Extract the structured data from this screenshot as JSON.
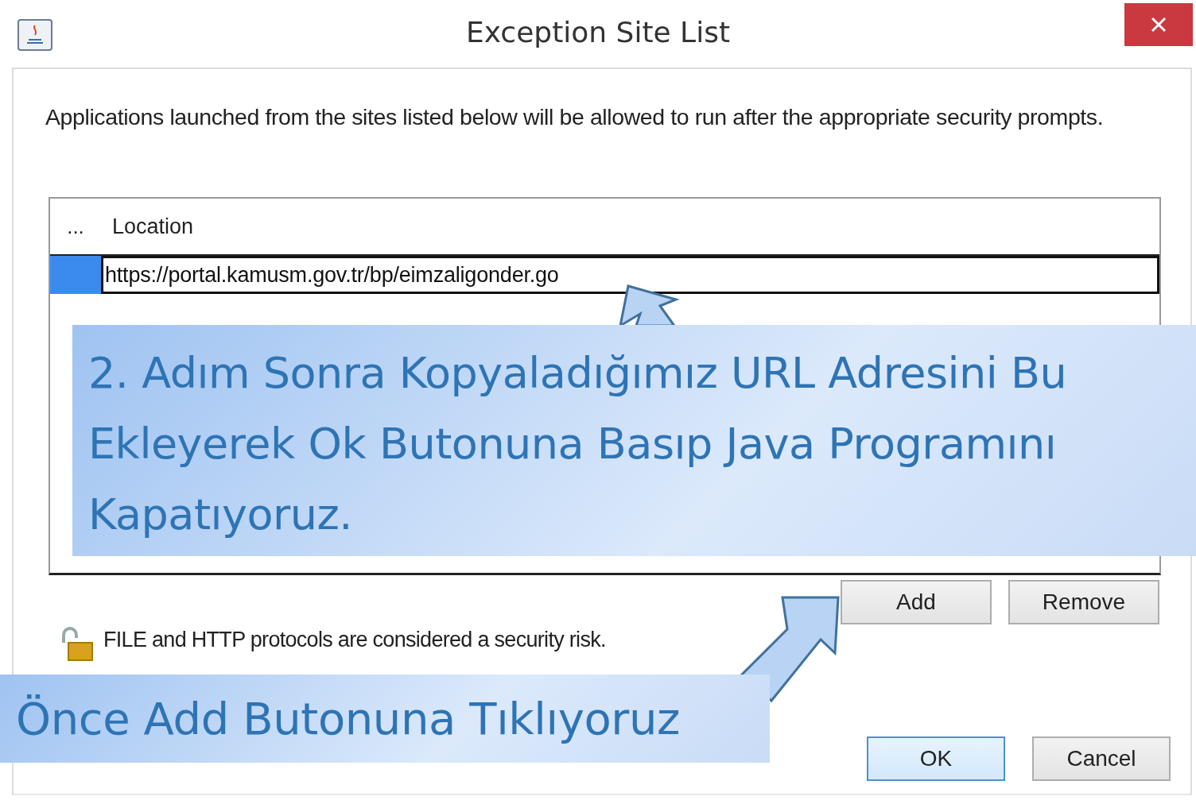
{
  "window": {
    "title": "Exception Site List"
  },
  "description": "Applications launched from the sites listed below will be allowed to run after the appropriate security prompts.",
  "table": {
    "columns": [
      "...",
      "Location"
    ],
    "rows": [
      {
        "location": "https://portal.kamusm.gov.tr/bp/eimzaligonder.go",
        "selected": true
      }
    ]
  },
  "table_buttons": [
    "Add",
    "Remove"
  ],
  "warning": [
    "FILE and HTTP protocols are considered a security risk."
  ],
  "buttons": [
    {
      "label": "OK",
      "default": true
    },
    {
      "label": "Cancel",
      "default": false
    }
  ],
  "annotations": [
    {
      "lines": [
        "2. Adım Sonra Kopyaladığımız URL Adresini Bu",
        "Ekleyerek Ok Butonuna Basıp Java Programını",
        "Kapatıyoruz."
      ]
    },
    {
      "lines": [
        "Önce Add Butonuna Tıklıyoruz"
      ]
    }
  ]
}
